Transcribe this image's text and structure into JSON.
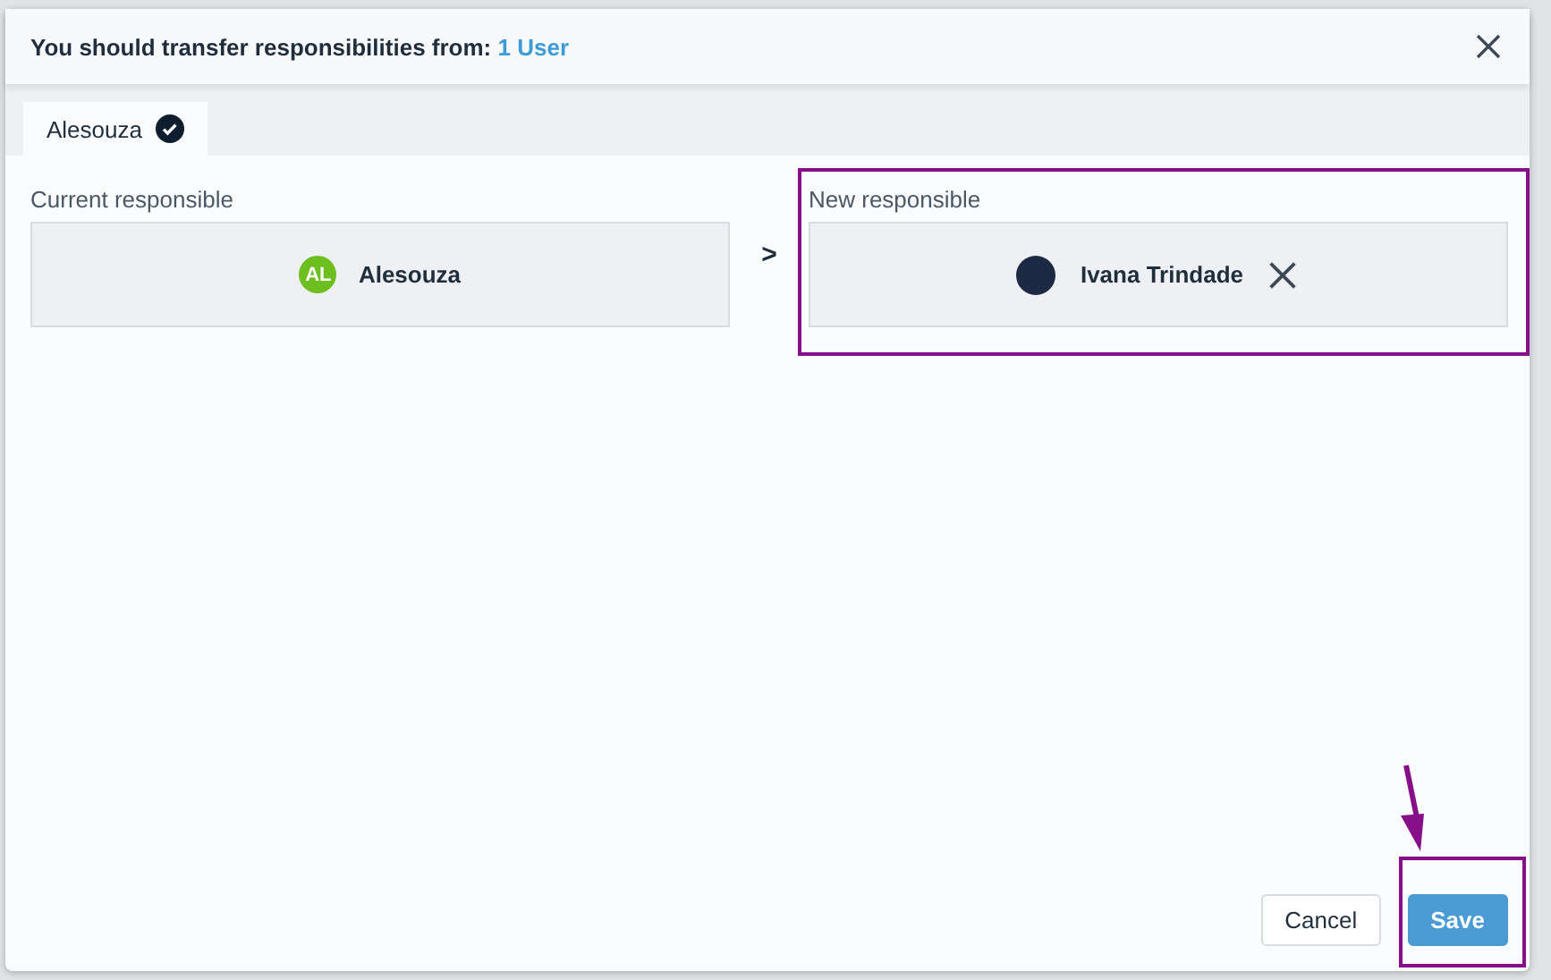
{
  "dialog": {
    "title": "You should transfer responsibilities from:",
    "title_link": "1 User"
  },
  "tabs": [
    {
      "label": "Alesouza",
      "selected": true,
      "done": true
    }
  ],
  "current": {
    "label": "Current responsible",
    "initials": "AL",
    "name": "Alesouza"
  },
  "separator": ">",
  "new": {
    "label": "New responsible",
    "name": "Ivana Trindade"
  },
  "buttons": [
    {
      "label": "Cancel",
      "kind": "secondary"
    },
    {
      "label": "Save",
      "kind": "primary"
    }
  ]
}
